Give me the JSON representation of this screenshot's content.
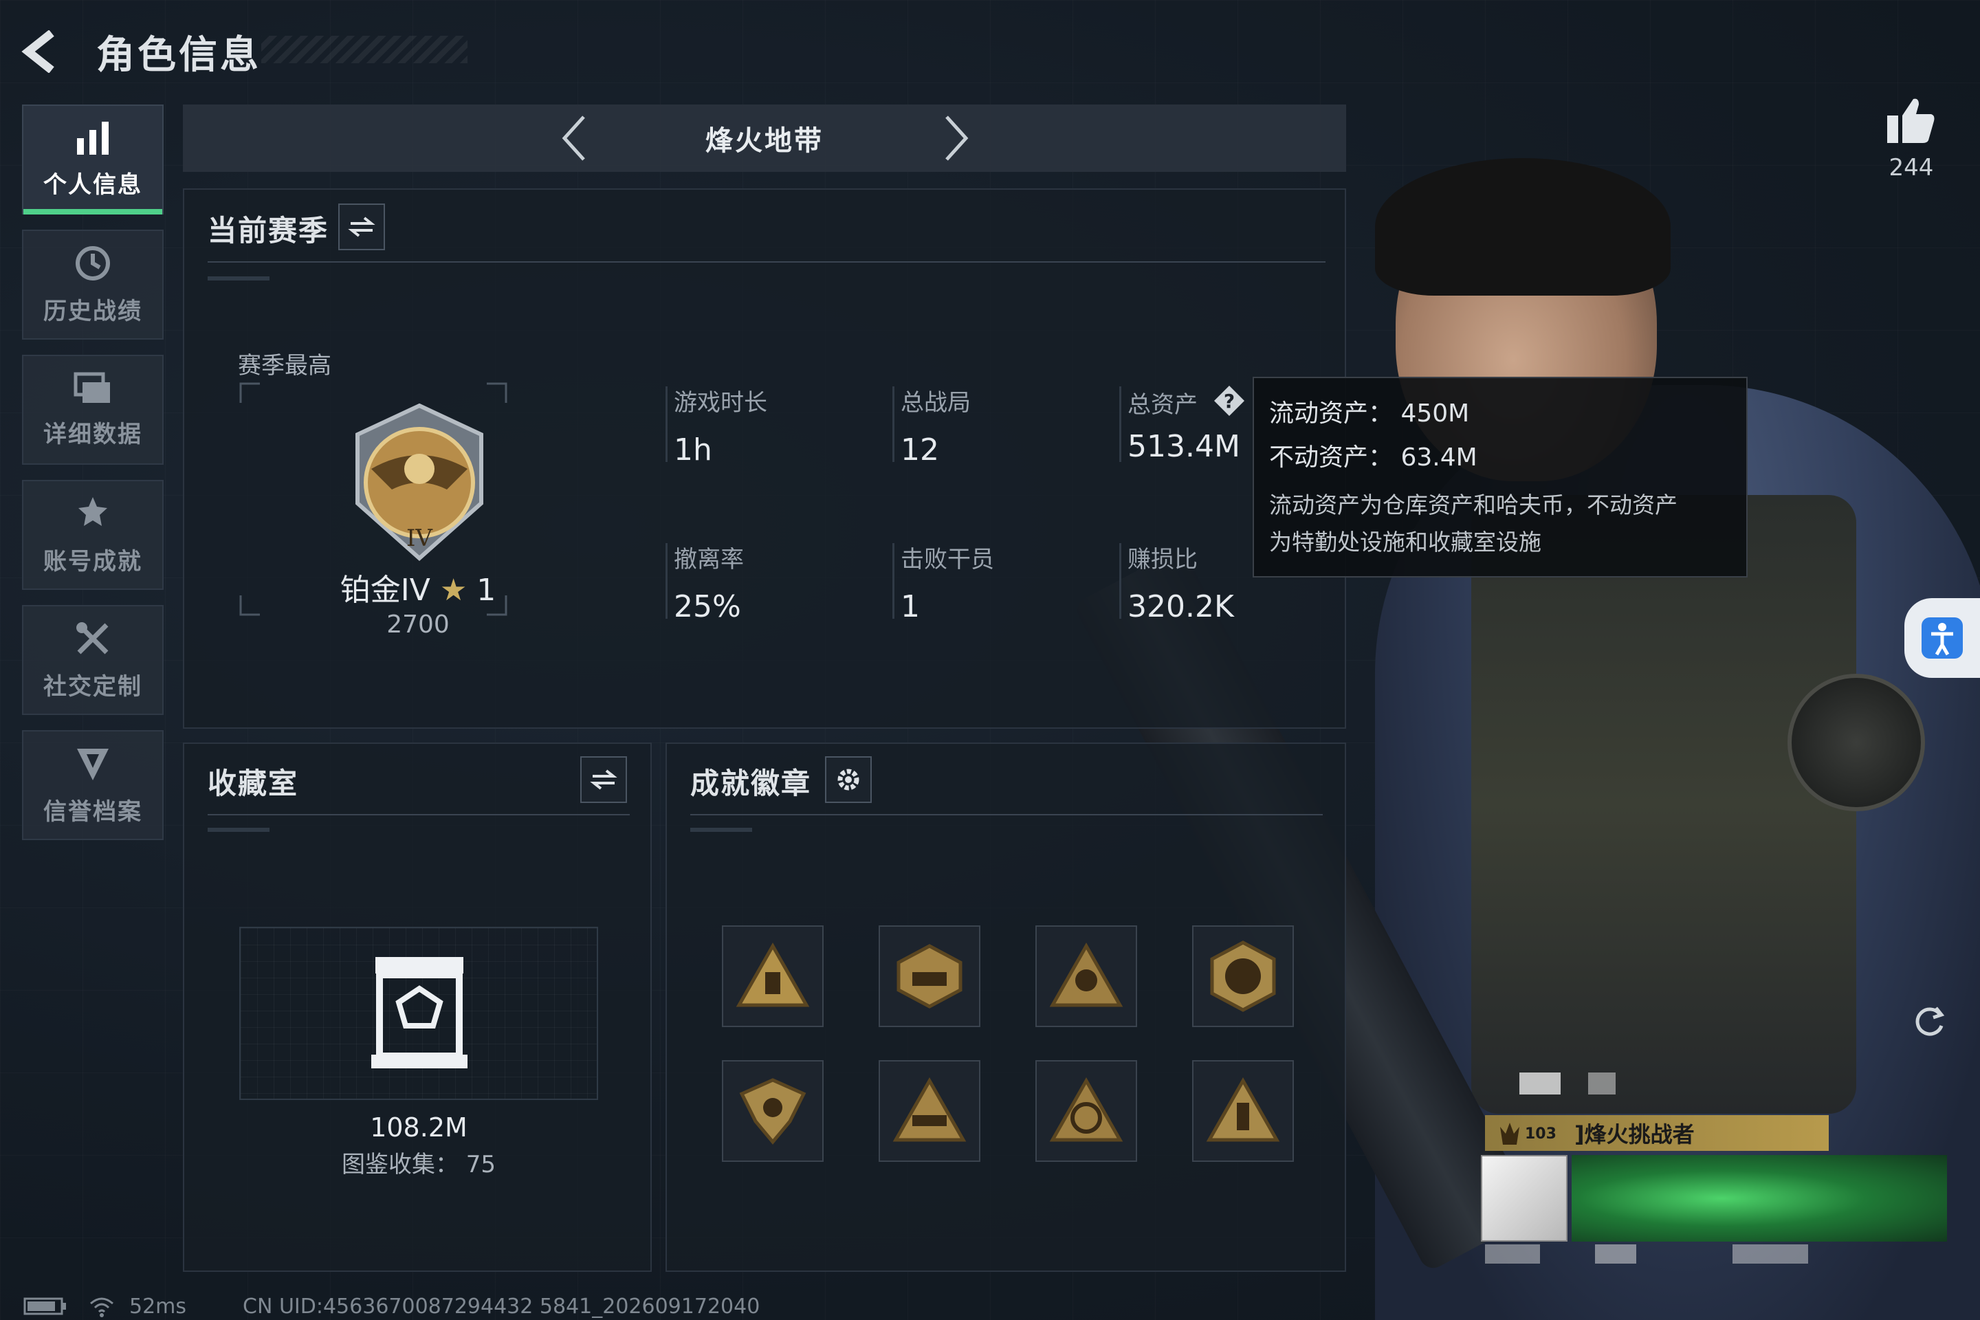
{
  "header": {
    "title": "角色信息"
  },
  "nav": {
    "items": [
      {
        "label": "个人信息",
        "icon": "bar-chart-icon",
        "active": true
      },
      {
        "label": "历史战绩",
        "icon": "history-clock-icon",
        "active": false
      },
      {
        "label": "详细数据",
        "icon": "data-cards-icon",
        "active": false
      },
      {
        "label": "账号成就",
        "icon": "achievement-icon",
        "active": false
      },
      {
        "label": "社交定制",
        "icon": "tools-icon",
        "active": false
      },
      {
        "label": "信誉档案",
        "icon": "credit-shield-icon",
        "active": false
      }
    ]
  },
  "mode": {
    "title": "烽火地带"
  },
  "season": {
    "title": "当前赛季",
    "highest_label": "赛季最高",
    "rank_name": "铂金IV",
    "rank_stars": "1",
    "rank_points": "2700",
    "stats": [
      {
        "label": "游戏时长",
        "value": "1h"
      },
      {
        "label": "总战局",
        "value": "12"
      },
      {
        "label": "总资产",
        "value": "513.4M"
      },
      {
        "label": "撤离率",
        "value": "25%"
      },
      {
        "label": "击败干员",
        "value": "1"
      },
      {
        "label": "赚损比",
        "value": "320.2K"
      }
    ]
  },
  "tooltip": {
    "liquid": "流动资产：  450M",
    "fixed": "不动资产：  63.4M",
    "desc_line1": "流动资产为仓库资产和哈夫币，不动资产",
    "desc_line2": "为特勤处设施和收藏室设施"
  },
  "collection": {
    "title": "收藏室",
    "value": "108.2M",
    "catalog": "图鉴收集：  75"
  },
  "badges": {
    "title": "成就徽章",
    "items": [
      {
        "icon": "triangle-badge-icon"
      },
      {
        "icon": "tank-badge-icon"
      },
      {
        "icon": "soldier-badge-icon"
      },
      {
        "icon": "delta-force-2026-badge-icon"
      },
      {
        "icon": "eagle-badge-icon"
      },
      {
        "icon": "vehicle-badge-icon"
      },
      {
        "icon": "eri-badge-icon"
      },
      {
        "icon": "tower-badge-icon"
      }
    ]
  },
  "likes": {
    "count": "244"
  },
  "player_card": {
    "level": "103",
    "name": "]烽火挑战者"
  },
  "status": {
    "ping": "52ms",
    "uid": "CN UID:4563670087294432 5841_202609172040"
  },
  "colors": {
    "accent_green": "#4fd08a",
    "gold": "#b79a4c",
    "panel_bg": "#161d25"
  }
}
